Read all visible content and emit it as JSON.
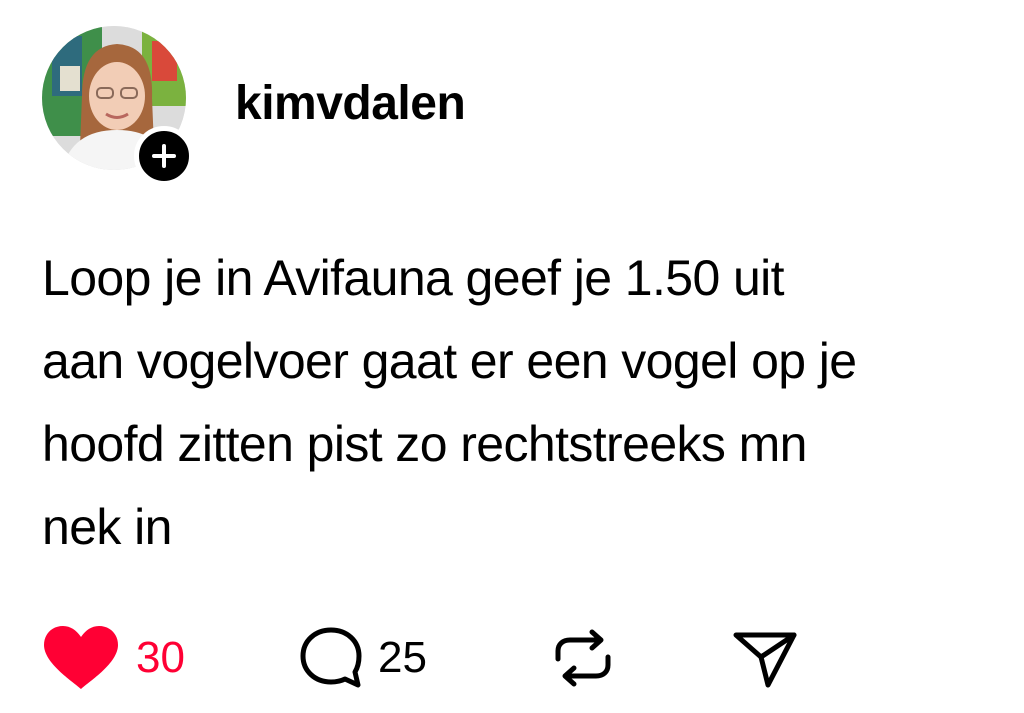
{
  "post": {
    "author": {
      "username": "kimvdalen",
      "avatar_icon": "profile-photo",
      "follow_icon": "plus-icon"
    },
    "text": "Loop je in Avifauna geef je 1.50 uit\naan vogelvoer gaat er een vogel op je\nhoofd zitten pist zo rechtstreeks mn\nnek in",
    "actions": {
      "likes": "30",
      "comments": "25",
      "like_icon": "heart-icon",
      "comment_icon": "comment-bubble-icon",
      "repost_icon": "repost-icon",
      "share_icon": "send-icon"
    },
    "colors": {
      "liked": "#ff0034",
      "text": "#000000",
      "background": "#ffffff"
    }
  }
}
